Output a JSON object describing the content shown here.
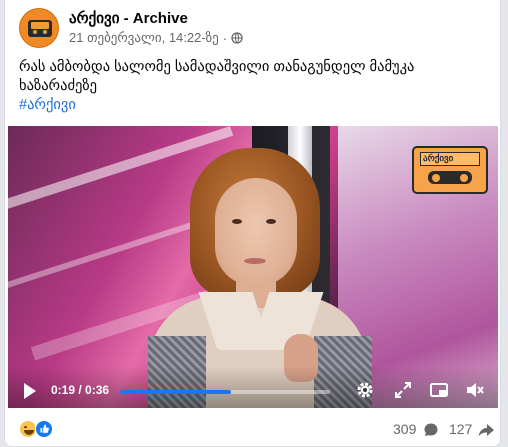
{
  "post": {
    "page_name": "არქივი - Archive",
    "timestamp": "21 თებერვალი, 14:22-ზე",
    "separator": "·",
    "caption": "რას ამბობდა სალომე სამადაშვილი თანაგუნდელ მამუკა ხაზარაძეზე",
    "hashtag": "#არქივი"
  },
  "video": {
    "current_time": "0:19",
    "duration": "0:36",
    "time_display": "0:19 / 0:36",
    "progress_fraction": 0.53,
    "logo_text": "არქივი"
  },
  "footer": {
    "comments_count": "309",
    "shares_count": "127"
  },
  "colors": {
    "accent": "#1877f2",
    "brand_orange": "#f08a24"
  },
  "icons": {
    "privacy": "globe-icon",
    "more": "more-options-icon",
    "play": "play-icon",
    "settings": "gear-icon",
    "expand": "expand-icon",
    "pip": "picture-in-picture-icon",
    "mute": "speaker-muted-icon",
    "comment": "comment-bubble-icon",
    "share": "share-arrow-icon"
  }
}
